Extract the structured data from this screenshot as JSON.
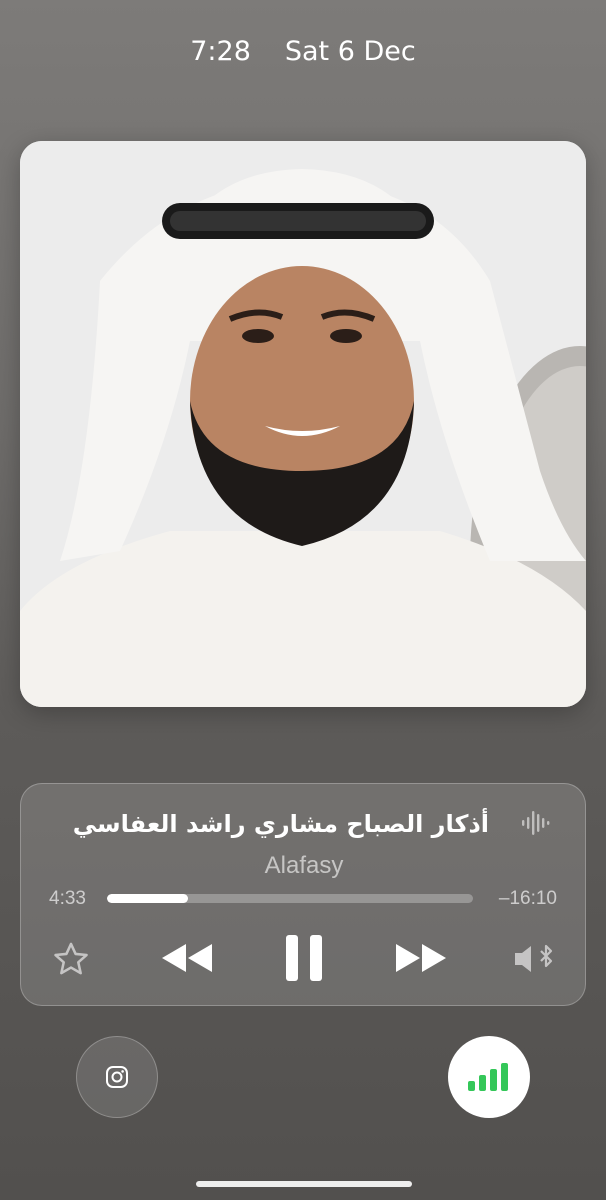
{
  "status_bar": {
    "time": "7:28",
    "date": "Sat 6 Dec"
  },
  "now_playing": {
    "title": "أذكار الصباح مشاري راشد العفاسي",
    "artist": "Alafasy",
    "elapsed": "4:33",
    "remaining": "–16:10",
    "progress_fraction": 0.22
  },
  "icons": {
    "waveform": "waveform-icon",
    "star": "star-icon",
    "rewind": "rewind-icon",
    "pause": "pause-icon",
    "forward": "fast-forward-icon",
    "speaker": "bluetooth-speaker-icon",
    "instagram": "instagram-icon",
    "signal": "signal-bars-icon"
  },
  "colors": {
    "signal_green": "#34c759"
  }
}
